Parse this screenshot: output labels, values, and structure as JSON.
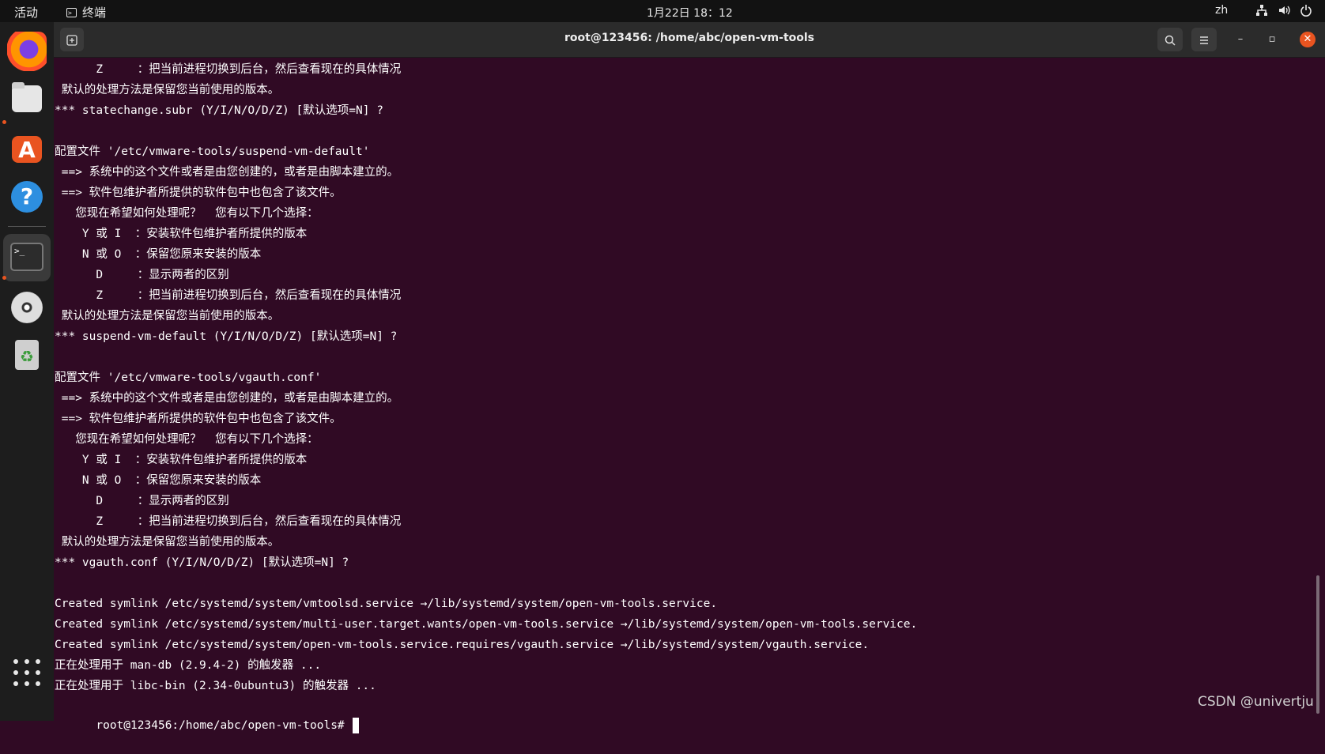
{
  "topbar": {
    "activities": "活动",
    "app_name": "终端",
    "clock": "1月22日  18：12",
    "lang": "zh"
  },
  "window": {
    "title": "root@123456: /home/abc/open-vm-tools"
  },
  "terminal": {
    "lines": [
      "      Z     ：把当前进程切换到后台，然后查看现在的具体情况",
      " 默认的处理方法是保留您当前使用的版本。",
      "*** statechange.subr (Y/I/N/O/D/Z) [默认选项=N] ?",
      "",
      "配置文件 '/etc/vmware-tools/suspend-vm-default'",
      " ==> 系统中的这个文件或者是由您创建的，或者是由脚本建立的。",
      " ==> 软件包维护者所提供的软件包中也包含了该文件。",
      "   您现在希望如何处理呢？  您有以下几个选择：",
      "    Y 或 I  ：安装软件包维护者所提供的版本",
      "    N 或 O  ：保留您原来安装的版本",
      "      D     ：显示两者的区别",
      "      Z     ：把当前进程切换到后台，然后查看现在的具体情况",
      " 默认的处理方法是保留您当前使用的版本。",
      "*** suspend-vm-default (Y/I/N/O/D/Z) [默认选项=N] ?",
      "",
      "配置文件 '/etc/vmware-tools/vgauth.conf'",
      " ==> 系统中的这个文件或者是由您创建的，或者是由脚本建立的。",
      " ==> 软件包维护者所提供的软件包中也包含了该文件。",
      "   您现在希望如何处理呢？  您有以下几个选择：",
      "    Y 或 I  ：安装软件包维护者所提供的版本",
      "    N 或 O  ：保留您原来安装的版本",
      "      D     ：显示两者的区别",
      "      Z     ：把当前进程切换到后台，然后查看现在的具体情况",
      " 默认的处理方法是保留您当前使用的版本。",
      "*** vgauth.conf (Y/I/N/O/D/Z) [默认选项=N] ?",
      "",
      "Created symlink /etc/systemd/system/vmtoolsd.service →/lib/systemd/system/open-vm-tools.service.",
      "Created symlink /etc/systemd/system/multi-user.target.wants/open-vm-tools.service →/lib/systemd/system/open-vm-tools.service.",
      "Created symlink /etc/systemd/system/open-vm-tools.service.requires/vgauth.service →/lib/systemd/system/vgauth.service.",
      "正在处理用于 man-db (2.9.4-2) 的触发器 ...",
      "正在处理用于 libc-bin (2.34-0ubuntu3) 的触发器 ..."
    ],
    "prompt": "root@123456:/home/abc/open-vm-tools# "
  },
  "dock": {
    "icons": [
      "firefox-icon",
      "files-icon",
      "software-icon",
      "help-icon",
      "terminal-icon",
      "disc-icon",
      "trash-icon",
      "apps-grid-icon"
    ],
    "active_color": "#e95420"
  },
  "watermark": "CSDN @univertju",
  "colors": {
    "terminal_bg": "#300a24",
    "accent": "#e95420"
  }
}
